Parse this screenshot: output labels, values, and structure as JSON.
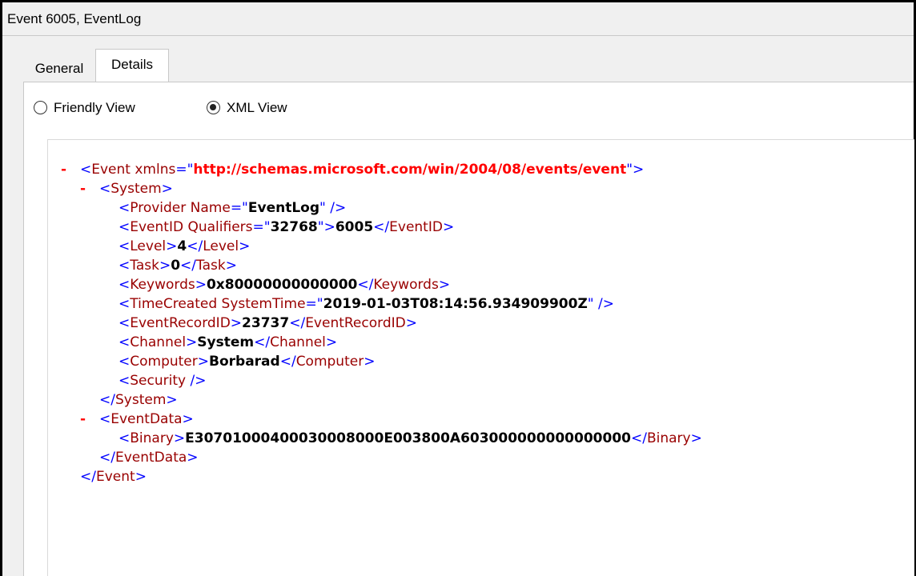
{
  "window": {
    "title": "Event 6005, EventLog"
  },
  "tabs": [
    {
      "label": "General"
    },
    {
      "label": "Details"
    }
  ],
  "view_options": {
    "friendly": "Friendly View",
    "xml": "XML View",
    "selected": "XML View"
  },
  "xml": {
    "collapse_symbol": "-",
    "event_tag": "Event",
    "xmlns_attr": "xmlns",
    "xmlns_value": "http://schemas.microsoft.com/win/2004/08/events/event",
    "system_tag": "System",
    "provider_tag": "Provider",
    "provider_attr": "Name",
    "provider_value": "EventLog",
    "eventid_tag": "EventID",
    "eventid_attr": "Qualifiers",
    "eventid_qualifiers": "32768",
    "eventid_value": "6005",
    "level_tag": "Level",
    "level_value": "4",
    "task_tag": "Task",
    "task_value": "0",
    "keywords_tag": "Keywords",
    "keywords_value": "0x80000000000000",
    "timecreated_tag": "TimeCreated",
    "timecreated_attr": "SystemTime",
    "timecreated_value": "2019-01-03T08:14:56.934909900Z",
    "recordid_tag": "EventRecordID",
    "recordid_value": "23737",
    "channel_tag": "Channel",
    "channel_value": "System",
    "computer_tag": "Computer",
    "computer_value": "Borbarad",
    "security_tag": "Security",
    "eventdata_tag": "EventData",
    "binary_tag": "Binary",
    "binary_value": "E30701000400030008000E003800A603000000000000000"
  }
}
